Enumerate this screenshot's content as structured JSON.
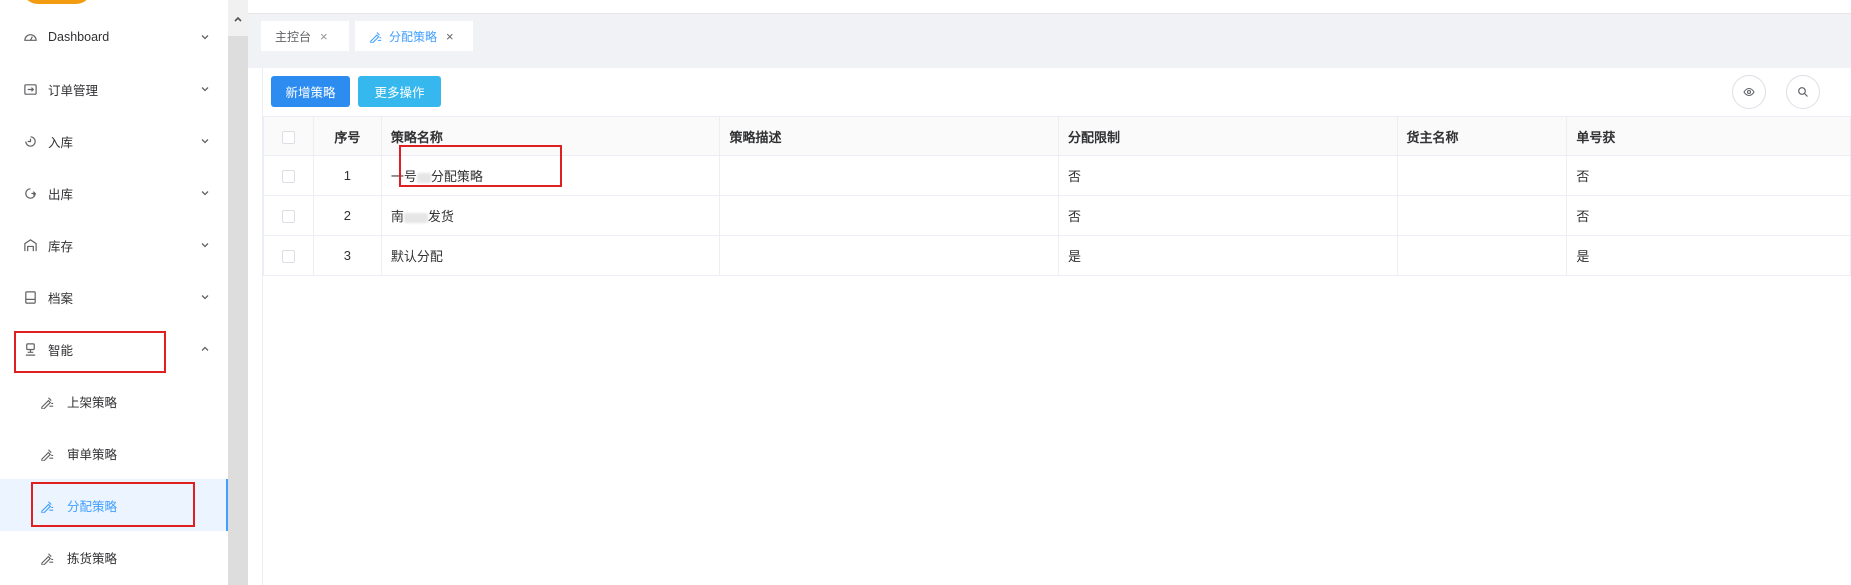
{
  "sidebar": {
    "menu": [
      {
        "label": "Dashboard",
        "icon": "dashboard-icon"
      },
      {
        "label": "订单管理",
        "icon": "order-icon"
      },
      {
        "label": "入库",
        "icon": "inbound-icon"
      },
      {
        "label": "出库",
        "icon": "outbound-icon"
      },
      {
        "label": "库存",
        "icon": "inventory-icon"
      },
      {
        "label": "档案",
        "icon": "archive-icon"
      },
      {
        "label": "智能",
        "icon": "smart-icon"
      }
    ],
    "submenu": [
      {
        "label": "上架策略",
        "icon": "strategy-icon"
      },
      {
        "label": "审单策略",
        "icon": "strategy-icon"
      },
      {
        "label": "分配策略",
        "icon": "strategy-icon",
        "active": true
      },
      {
        "label": "拣货策略",
        "icon": "strategy-icon"
      }
    ]
  },
  "tabs": [
    {
      "label": "主控台",
      "close": "×"
    },
    {
      "label": "分配策略",
      "close": "×",
      "active": true
    }
  ],
  "toolbar": {
    "add_label": "新增策略",
    "more_label": "更多操作"
  },
  "table": {
    "columns": [
      "序号",
      "策略名称",
      "策略描述",
      "分配限制",
      "货主名称",
      "单号获"
    ],
    "rows": [
      {
        "index": "1",
        "name_prefix": "一号",
        "name_suffix": "分配策略",
        "desc": "",
        "limit": "否",
        "owner": "",
        "order": "否"
      },
      {
        "index": "2",
        "name_prefix": "南",
        "name_suffix": "发货",
        "desc": "",
        "limit": "否",
        "owner": "",
        "order": "否"
      },
      {
        "index": "3",
        "name_prefix": "",
        "name_suffix": "默认分配",
        "desc": "",
        "limit": "是",
        "owner": "",
        "order": "是"
      }
    ]
  },
  "colors": {
    "primary": "#2d8cf0",
    "info": "#36b8ee",
    "active_text": "#409eff",
    "highlight_box": "#e02020"
  }
}
